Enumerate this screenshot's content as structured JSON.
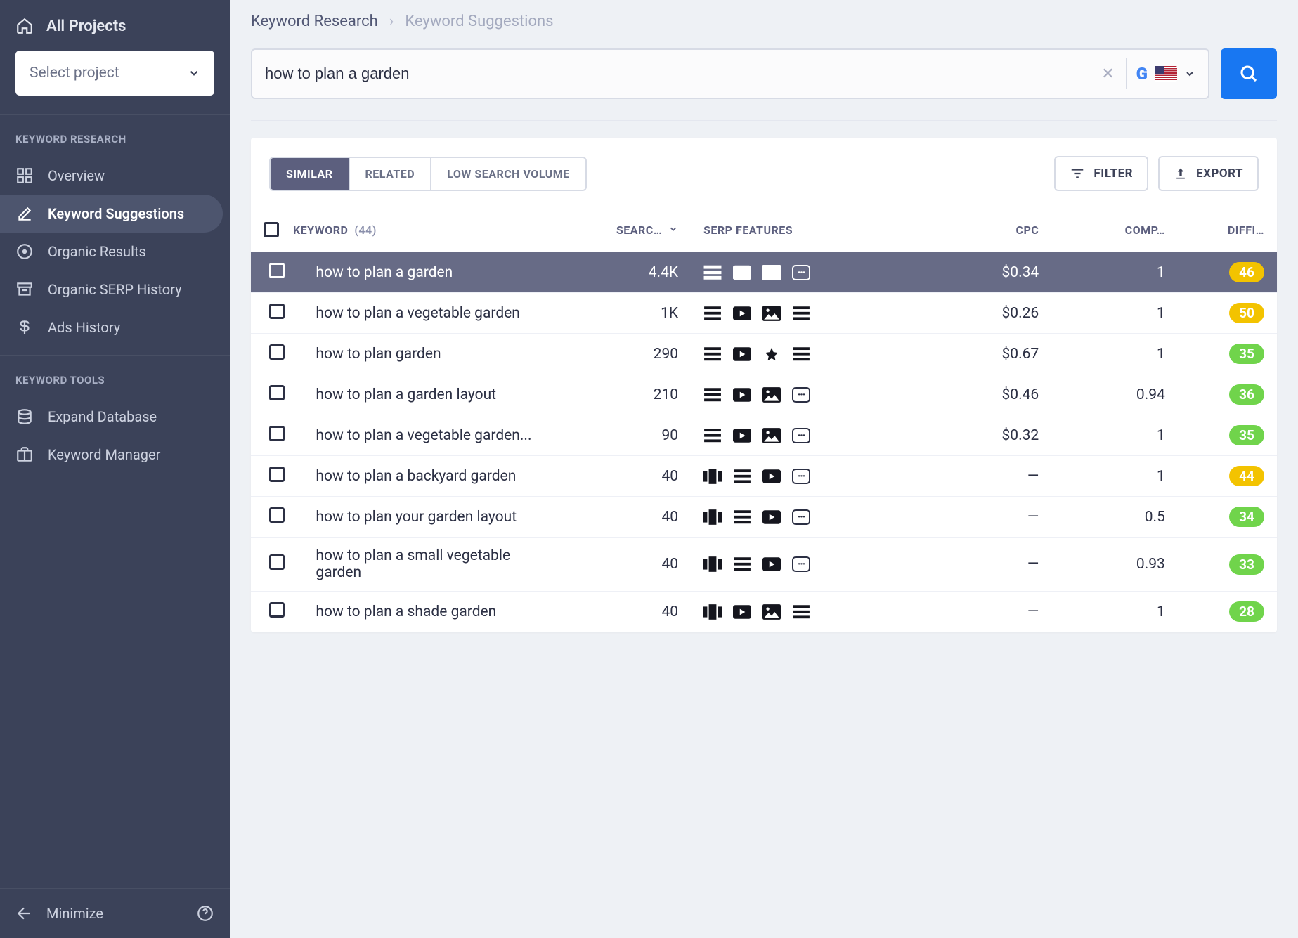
{
  "sidebar": {
    "all_projects": "All Projects",
    "select_project": "Select project",
    "sections": {
      "research": {
        "title": "KEYWORD RESEARCH",
        "items": [
          "Overview",
          "Keyword Suggestions",
          "Organic Results",
          "Organic SERP History",
          "Ads History"
        ],
        "active_index": 1
      },
      "tools": {
        "title": "KEYWORD TOOLS",
        "items": [
          "Expand Database",
          "Keyword Manager"
        ]
      }
    },
    "minimize": "Minimize"
  },
  "breadcrumb": {
    "root": "Keyword Research",
    "current": "Keyword Suggestions"
  },
  "search": {
    "value": "how to plan a garden"
  },
  "tabs": {
    "items": [
      "SIMILAR",
      "RELATED",
      "LOW SEARCH VOLUME"
    ],
    "active_index": 0
  },
  "actions": {
    "filter": "FILTER",
    "export": "EXPORT"
  },
  "table": {
    "headers": {
      "keyword": "KEYWORD",
      "count": "(44)",
      "search": "SEARC…",
      "serp": "SERP FEATURES",
      "cpc": "CPC",
      "comp": "COMP…",
      "diff": "DIFFI…"
    },
    "rows": [
      {
        "kw": "how to plan a garden",
        "search": "4.4K",
        "cpc": "$0.34",
        "comp": "1",
        "diff": 46,
        "diff_color": "#f3c300",
        "serp": [
          "lines",
          "video",
          "image",
          "more"
        ],
        "highlight": true
      },
      {
        "kw": "how to plan a vegetable garden",
        "search": "1K",
        "cpc": "$0.26",
        "comp": "1",
        "diff": 50,
        "diff_color": "#f3c300",
        "serp": [
          "lines",
          "video",
          "image",
          "lines"
        ]
      },
      {
        "kw": "how to plan garden",
        "search": "290",
        "cpc": "$0.67",
        "comp": "1",
        "diff": 35,
        "diff_color": "#70d44b",
        "serp": [
          "lines",
          "video",
          "star",
          "lines"
        ]
      },
      {
        "kw": "how to plan a garden layout",
        "search": "210",
        "cpc": "$0.46",
        "comp": "0.94",
        "diff": 36,
        "diff_color": "#70d44b",
        "serp": [
          "lines",
          "video",
          "image",
          "more"
        ]
      },
      {
        "kw": "how to plan a vegetable garden...",
        "search": "90",
        "cpc": "$0.32",
        "comp": "1",
        "diff": 35,
        "diff_color": "#70d44b",
        "serp": [
          "lines",
          "video",
          "image",
          "more"
        ]
      },
      {
        "kw": "how to plan a backyard garden",
        "search": "40",
        "cpc": "—",
        "comp": "1",
        "diff": 44,
        "diff_color": "#f3c300",
        "serp": [
          "carousel",
          "lines",
          "video",
          "more"
        ]
      },
      {
        "kw": "how to plan your garden layout",
        "search": "40",
        "cpc": "—",
        "comp": "0.5",
        "diff": 34,
        "diff_color": "#70d44b",
        "serp": [
          "carousel",
          "lines",
          "video",
          "more"
        ]
      },
      {
        "kw": "how to plan a small vegetable garden",
        "search": "40",
        "cpc": "—",
        "comp": "0.93",
        "diff": 33,
        "diff_color": "#70d44b",
        "serp": [
          "carousel",
          "lines",
          "video",
          "more"
        ]
      },
      {
        "kw": "how to plan a shade garden",
        "search": "40",
        "cpc": "—",
        "comp": "1",
        "diff": 28,
        "diff_color": "#70d44b",
        "serp": [
          "carousel",
          "video",
          "image",
          "lines"
        ]
      }
    ]
  }
}
